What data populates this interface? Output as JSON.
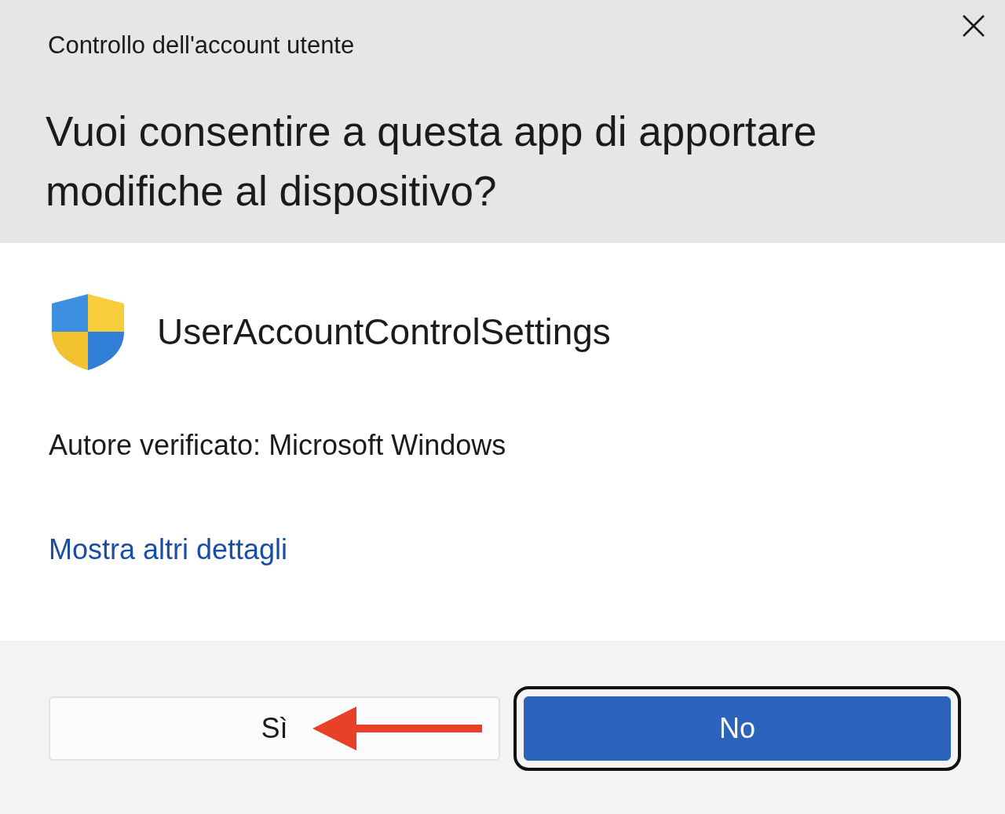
{
  "window": {
    "title": "Controllo dell'account utente"
  },
  "question": "Vuoi consentire a questa app di apportare modifiche al dispositivo?",
  "app": {
    "name": "UserAccountControlSettings"
  },
  "publisher": "Autore verificato: Microsoft Windows",
  "details_link": "Mostra altri dettagli",
  "buttons": [
    {
      "label": "Sì",
      "kind": "default",
      "focused": false,
      "annotated": true
    },
    {
      "label": "No",
      "kind": "primary",
      "focused": true,
      "annotated": false
    }
  ]
}
